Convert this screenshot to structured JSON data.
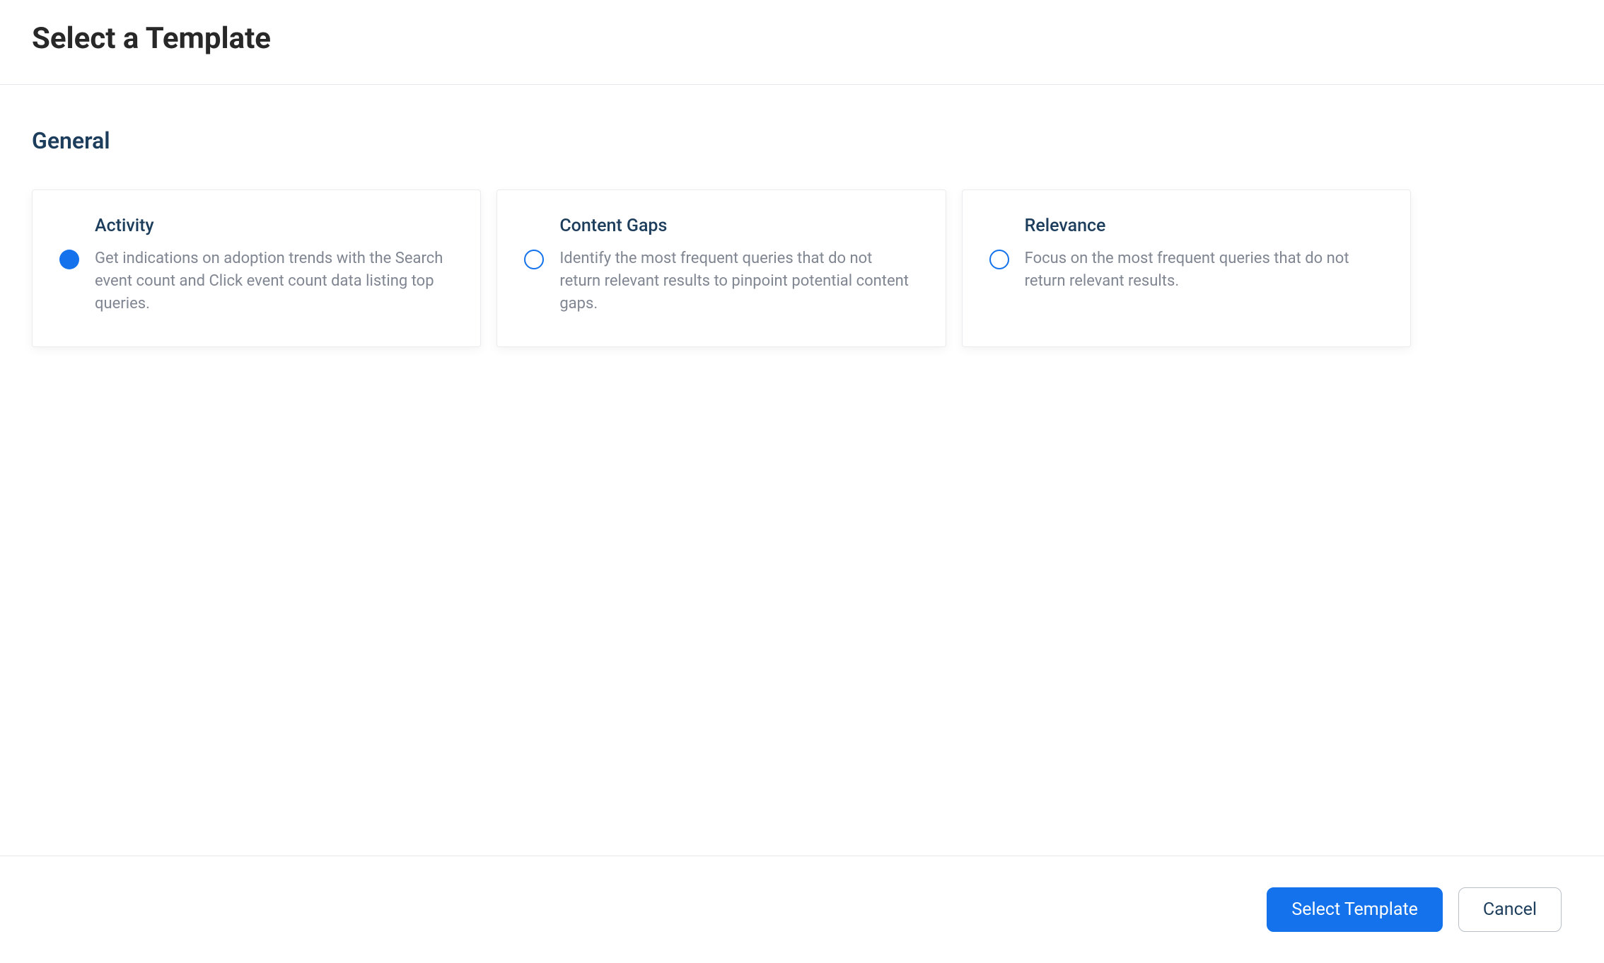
{
  "header": {
    "title": "Select a Template"
  },
  "section": {
    "heading": "General"
  },
  "templates": [
    {
      "title": "Activity",
      "description": "Get indications on adoption trends with the Search event count and Click event count data listing top queries.",
      "selected": true
    },
    {
      "title": "Content Gaps",
      "description": "Identify the most frequent queries that do not return relevant results to pinpoint potential content gaps.",
      "selected": false
    },
    {
      "title": "Relevance",
      "description": "Focus on the most frequent queries that do not return relevant results.",
      "selected": false
    }
  ],
  "footer": {
    "primary_label": "Select Template",
    "secondary_label": "Cancel"
  }
}
